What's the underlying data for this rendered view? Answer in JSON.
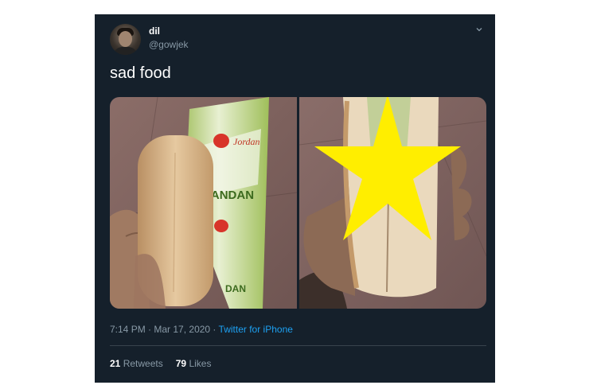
{
  "user": {
    "display_name": "dil",
    "handle": "@gowjek"
  },
  "tweet": {
    "text": "sad food"
  },
  "media": {
    "left_packet_text": {
      "brand": "Jordan",
      "flavor": "PANDAN",
      "flavor_cut": "DAN"
    }
  },
  "meta": {
    "time": "7:14 PM",
    "separator1": " · ",
    "date": "Mar 17, 2020",
    "separator2": " · ",
    "source": "Twitter for iPhone"
  },
  "stats": {
    "retweets_count": "21",
    "retweets_label": "Retweets",
    "likes_count": "79",
    "likes_label": "Likes"
  },
  "colors": {
    "background": "#15202b",
    "secondary_text": "#8899a6",
    "link": "#1da1f2",
    "divider": "#38444d",
    "star": "#ffee00"
  },
  "icons": [
    "chevron-down-icon",
    "star-icon"
  ]
}
